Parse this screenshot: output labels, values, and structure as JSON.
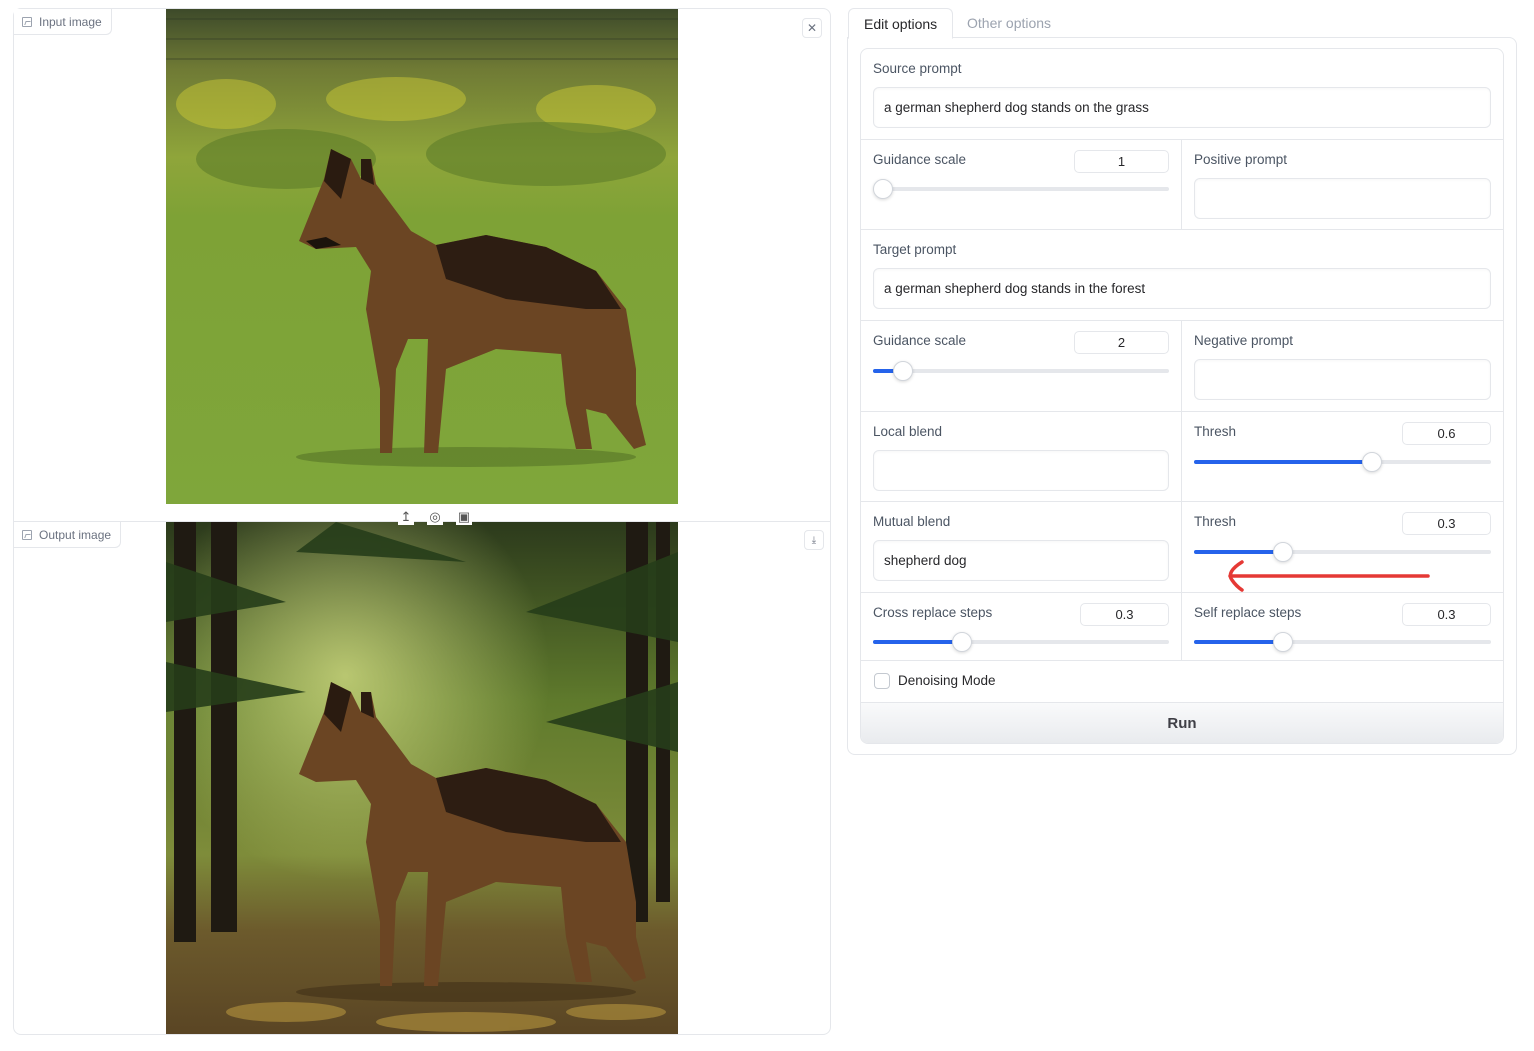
{
  "input_panel": {
    "label": "Input image"
  },
  "output_panel": {
    "label": "Output image"
  },
  "tabs": [
    {
      "label": "Edit options",
      "active": true
    },
    {
      "label": "Other options",
      "active": false
    }
  ],
  "source_prompt": {
    "label": "Source prompt",
    "value": "a german shepherd dog stands on the grass"
  },
  "guidance_scale_1": {
    "label": "Guidance scale",
    "value": "1",
    "fraction": 0.0
  },
  "positive_prompt": {
    "label": "Positive prompt",
    "value": ""
  },
  "target_prompt": {
    "label": "Target prompt",
    "value": "a german shepherd dog stands in the forest"
  },
  "guidance_scale_2": {
    "label": "Guidance scale",
    "value": "2",
    "fraction": 0.1
  },
  "negative_prompt": {
    "label": "Negative prompt",
    "value": ""
  },
  "local_blend": {
    "label": "Local blend",
    "value": ""
  },
  "thresh_local": {
    "label": "Thresh",
    "value": "0.6",
    "fraction": 0.6
  },
  "mutual_blend": {
    "label": "Mutual blend",
    "value": "shepherd dog"
  },
  "thresh_mutual": {
    "label": "Thresh",
    "value": "0.3",
    "fraction": 0.3
  },
  "cross_replace_steps": {
    "label": "Cross replace steps",
    "value": "0.3",
    "fraction": 0.3
  },
  "self_replace_steps": {
    "label": "Self replace steps",
    "value": "0.3",
    "fraction": 0.3
  },
  "denoising_mode": {
    "label": "Denoising Mode",
    "checked": false
  },
  "run_button": {
    "label": "Run"
  },
  "colors": {
    "accent": "#2563eb",
    "annotation": "#e53935"
  }
}
